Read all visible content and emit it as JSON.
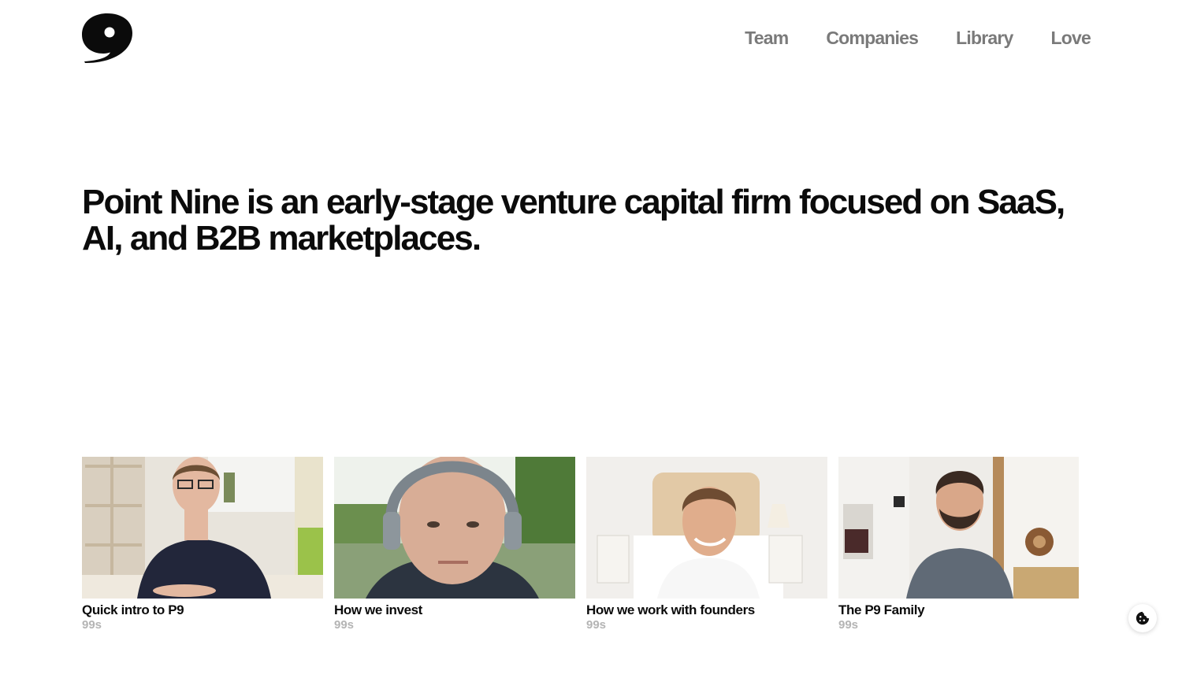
{
  "header": {
    "logo_icon": "point-nine-comma-logo",
    "nav": [
      {
        "label": "Team"
      },
      {
        "label": "Companies"
      },
      {
        "label": "Library"
      },
      {
        "label": "Love"
      }
    ]
  },
  "hero": {
    "headline": "Point Nine is an early-stage venture capital firm focused on SaaS, AI, and B2B marketplaces."
  },
  "videos": [
    {
      "title": "Quick intro to P9",
      "duration": "99s"
    },
    {
      "title": "How we invest",
      "duration": "99s"
    },
    {
      "title": "How we work with founders",
      "duration": "99s"
    },
    {
      "title": "The P9 Family",
      "duration": "99s"
    }
  ],
  "cookie_button": {
    "icon": "cookie-icon"
  },
  "colors": {
    "text": "#0b0b0b",
    "nav": "#7a7a7a",
    "muted": "#b4b4b4",
    "background": "#ffffff"
  }
}
